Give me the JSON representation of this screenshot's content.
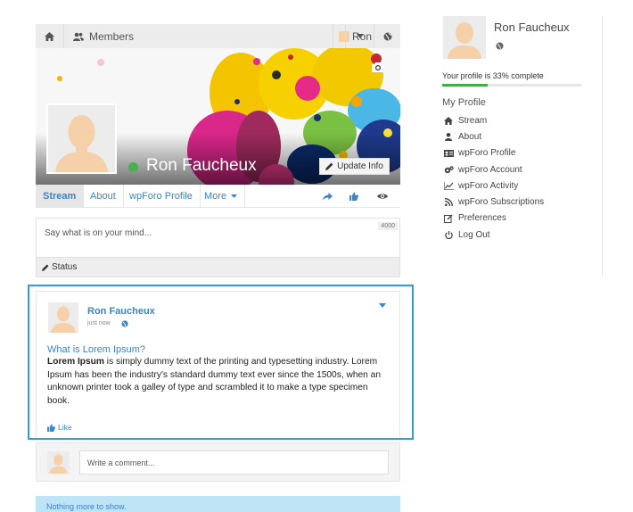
{
  "topnav": {
    "home_icon": "home-icon",
    "members_label": "Members",
    "members_icon": "users-icon",
    "user_label": "Ron",
    "caret_icon": "caret-down-icon",
    "globe_icon": "globe-icon"
  },
  "cover": {
    "name": "Ron Faucheux",
    "update_label": "Update Info",
    "camera_icon": "camera-icon",
    "online": true
  },
  "tabs": [
    {
      "label": "Stream",
      "active": true
    },
    {
      "label": "About",
      "active": false
    },
    {
      "label": "wpForo Profile",
      "active": false
    },
    {
      "label": "More",
      "active": false
    }
  ],
  "tab_icons": [
    "share-icon",
    "thumbs-up-icon",
    "eye-icon"
  ],
  "status": {
    "placeholder": "Say what is on your mind...",
    "char_count": "4000",
    "bar_label": "Status"
  },
  "post": {
    "author": "Ron Faucheux",
    "time": "just now",
    "title": "What is Lorem Ipsum?",
    "body_bold": "Lorem Ipsum",
    "body_rest": " is simply dummy text of the printing and typesetting industry. Lorem Ipsum has been the industry's standard dummy text ever since the 1500s, when an unknown printer took a galley of type and scrambled it to make a type specimen book.",
    "like_label": "Like"
  },
  "comment": {
    "placeholder": "Write a comment..."
  },
  "feed_end": "Nothing more to show.",
  "sidebar": {
    "name": "Ron Faucheux",
    "complete_text": "Your profile is 33% complete",
    "complete_pct": 33,
    "heading": "My Profile",
    "items": [
      {
        "label": "Stream",
        "icon": "home-icon"
      },
      {
        "label": "About",
        "icon": "user-icon"
      },
      {
        "label": "wpForo Profile",
        "icon": "id-card-icon"
      },
      {
        "label": "wpForo Account",
        "icon": "cogs-icon"
      },
      {
        "label": "wpForo Activity",
        "icon": "chart-icon"
      },
      {
        "label": "wpForo Subscriptions",
        "icon": "rss-icon"
      },
      {
        "label": "Preferences",
        "icon": "edit-icon"
      },
      {
        "label": "Log Out",
        "icon": "power-icon"
      }
    ]
  },
  "colors": {
    "accent": "#3a85c3",
    "highlight": "#2f9ce0",
    "online": "#4caf50",
    "progress": "#3fae4a"
  }
}
